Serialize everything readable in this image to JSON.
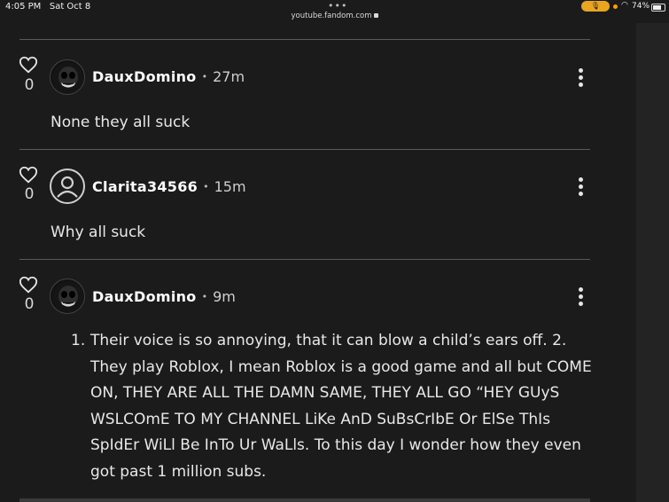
{
  "status_bar": {
    "time": "4:05 PM",
    "date": "Sat Oct 8",
    "url": "youtube.fandom.com",
    "battery": "74%"
  },
  "comments": [
    {
      "username": "DauxDomino",
      "time": "27m",
      "likes": "0",
      "avatar": "skull-avatar",
      "text": "None they all suck"
    },
    {
      "username": "Clarita34566",
      "time": "15m",
      "likes": "0",
      "avatar": "default-user-avatar",
      "text": "Why all suck"
    },
    {
      "username": "DauxDomino",
      "time": "9m",
      "likes": "0",
      "avatar": "skull-avatar",
      "list_number": "1.",
      "text": "Their voice is so annoying, that it can blow a child’s ears off. 2. They play Roblox, I mean Roblox is a good game and all but COME ON, THEY ARE ALL THE DAMN SAME, THEY ALL GO “HEY GUyS WSLCOmE TO MY CHANNEL LiKe AnD SuBsCrIbE Or ElSe ThIs SpIdEr WiLl Be InTo Ur WaLls. To this day I wonder how they even got past 1 million subs."
    }
  ],
  "separator": "•",
  "colors": {
    "background": "#1b1b1b",
    "divider": "#5a5a5a",
    "mic_indicator": "#e8a520",
    "text": "#e8e8e8"
  }
}
